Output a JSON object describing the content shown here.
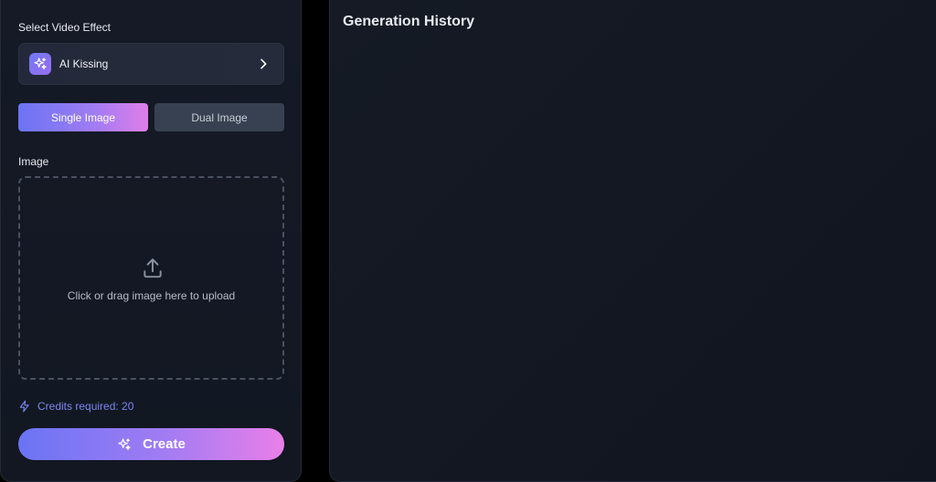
{
  "left_panel": {
    "select_effect_label": "Select Video Effect",
    "effect": {
      "name": "AI Kissing",
      "icon": "sparkles-icon"
    },
    "modes": [
      {
        "label": "Single Image",
        "active": true
      },
      {
        "label": "Dual Image",
        "active": false
      }
    ],
    "image_label": "Image",
    "upload": {
      "icon": "upload-icon",
      "text": "Click or drag image here to upload"
    },
    "credits": {
      "icon": "lightning-icon",
      "text": "Credits required: 20"
    },
    "create_button": {
      "icon": "sparkles-icon",
      "label": "Create"
    }
  },
  "right_panel": {
    "title": "Generation History"
  },
  "colors": {
    "accent_start": "#6a74f4",
    "accent_end": "#ea7fe9",
    "credits_text": "#7b86f0",
    "background": "#000000"
  }
}
